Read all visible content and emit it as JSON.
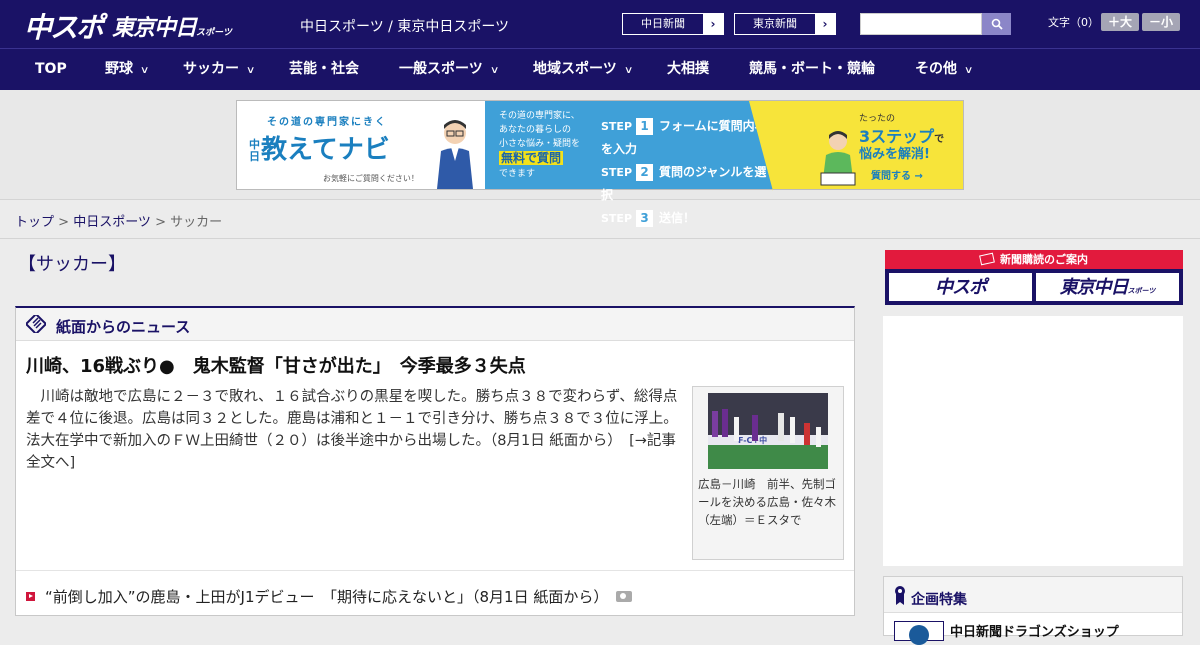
{
  "header": {
    "logo_chunichi_sports": "中スポ",
    "logo_tokyo_chunichi": "東京中日",
    "logo_tokyo_chunichi_suffix": "スポーツ",
    "site_title": "中日スポーツ / 東京中日スポーツ",
    "btn_chunichi_shimbun": "中日新聞",
    "btn_tokyo_shimbun": "東京新聞",
    "arrow": "›",
    "search_placeholder": "",
    "search_icon": "search-icon",
    "font_size_label": "文字（0）",
    "font_larger": "＋大",
    "font_smaller": "－小"
  },
  "nav": {
    "items": [
      {
        "label": "TOP",
        "has_dropdown": false
      },
      {
        "label": "野球",
        "has_dropdown": true
      },
      {
        "label": "サッカー",
        "has_dropdown": true
      },
      {
        "label": "芸能・社会",
        "has_dropdown": false
      },
      {
        "label": "一般スポーツ",
        "has_dropdown": true
      },
      {
        "label": "地域スポーツ",
        "has_dropdown": true
      },
      {
        "label": "大相撲",
        "has_dropdown": false
      },
      {
        "label": "競馬・ボート・競輪",
        "has_dropdown": false
      },
      {
        "label": "その他",
        "has_dropdown": true
      }
    ],
    "chevron": "∨"
  },
  "banner": {
    "left_sub": "その道の専門家にきく",
    "left_prefix": "中日",
    "left_main": "教えてナビ",
    "left_note": "お気軽にご質問ください！",
    "mid_line1": "その道の専門家に、",
    "mid_line2": "あなたの暮らしの",
    "mid_line3": "小さな悩み・疑問を",
    "mid_free": "無料で質問",
    "mid_line5": "できます",
    "step_word": "STEP",
    "step1_num": "1",
    "step1_text": "フォームに質問内容を入力",
    "step2_num": "2",
    "step2_text": "質問のジャンルを選択",
    "step3_num": "3",
    "step3_text": "送信！",
    "right_t1": "たったの",
    "right_t2": "3ステップ",
    "right_t2b": "で",
    "right_t3": "悩みを解消!",
    "right_t4": "質問する →",
    "colors": {
      "blue": "#3fa0d8",
      "yellow": "#f7e43a"
    }
  },
  "breadcrumb": {
    "top": "トップ",
    "sep": " > ",
    "chunichi": "中日スポーツ",
    "current": "サッカー"
  },
  "main": {
    "section_title": "【サッカー】",
    "box_title": "紙面からのニュース",
    "box_icon": "newspaper-icon",
    "headline": "川崎、16戦ぶり●　鬼木監督「甘さが出た」　今季最多３失点",
    "body": "　川崎は敵地で広島に２－３で敗れ、１６試合ぶりの黒星を喫した。勝ち点３８で変わらず、総得点差で４位に後退。広島は同３２とした。鹿島は浦和と１－１で引き分け、勝ち点３８で３位に浮上。法大在学中で新加入のＦＷ上田綺世（２０）は後半途中から出場した。（8月1日 紙面から）　",
    "read_more": "[→記事全文へ]",
    "photo_caption": "広島－川崎　前半、先制ゴールを決める広島・佐々木（左端）＝Ｅスタで",
    "related_link": "“前倒し加入”の鹿島・上田がJ1デビュー　「期待に応えないと」（8月1日 紙面から）",
    "related_icon": "camera-icon"
  },
  "sidebar": {
    "subscribe_title": "新聞購読のご案内",
    "subscribe_chunichi": "中スポ",
    "subscribe_tokyo": "東京中日",
    "subscribe_tokyo_suffix": "スポーツ",
    "feature_title": "企画特集",
    "feature_item": "中日新聞ドラゴンズショップ"
  },
  "colors": {
    "brand_navy": "#1a1266",
    "subscribe_red": "#e21a3d",
    "link_bullet_red": "#d0163c"
  }
}
